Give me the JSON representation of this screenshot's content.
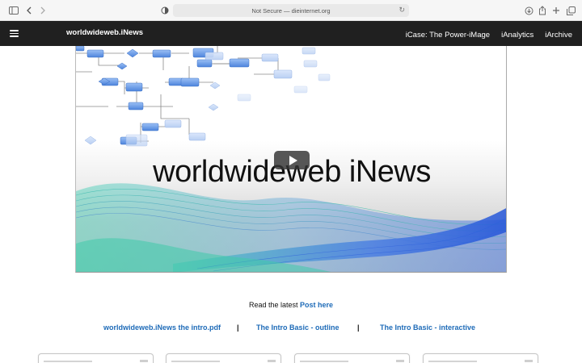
{
  "browser": {
    "url": "Not Secure — dieinternet.org",
    "icons": [
      "sidebar-icon",
      "back-icon",
      "forward-icon",
      "privacy-shield-icon",
      "reload-icon",
      "download-icon",
      "share-icon",
      "new-tab-icon",
      "tabs-overview-icon"
    ]
  },
  "header": {
    "brand": "worldwideweb.iNews",
    "nav": [
      "iCase: The Power-iMage",
      "iAnalytics",
      "iArchive"
    ]
  },
  "hero": {
    "title": "worldwideweb iNews"
  },
  "latest": {
    "prefix": "Read the latest",
    "link": "Post here"
  },
  "links": {
    "pdf": "worldwideweb.iNews the intro.pdf",
    "outline": "The Intro Basic - outline",
    "interactive": "The Intro Basic - interactive",
    "separator": "|"
  },
  "colors": {
    "header_bg": "#202020",
    "link": "#1e6bb8",
    "flow_blue": "#5a8fe0",
    "wave_teal": "#3cc7b5",
    "wave_blue": "#2f6fe0"
  }
}
